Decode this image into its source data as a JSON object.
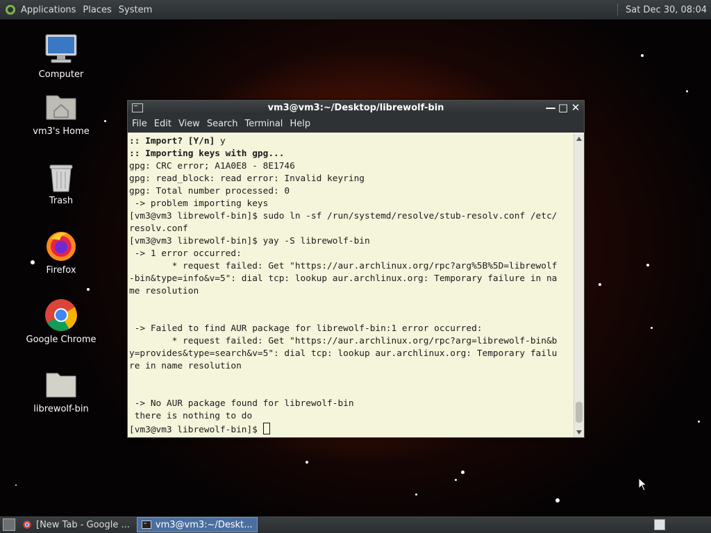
{
  "top_panel": {
    "menus": [
      "Applications",
      "Places",
      "System"
    ],
    "clock": "Sat Dec 30, 08:04"
  },
  "desktop_icons": [
    {
      "label": "Computer",
      "icon": "computer-icon"
    },
    {
      "label": "vm3's Home",
      "icon": "home-folder-icon"
    },
    {
      "label": "Trash",
      "icon": "trash-icon"
    },
    {
      "label": "Firefox",
      "icon": "firefox-icon"
    },
    {
      "label": "Google Chrome",
      "icon": "chrome-icon"
    },
    {
      "label": "librewolf-bin",
      "icon": "folder-icon"
    }
  ],
  "terminal": {
    "title": "vm3@vm3:~/Desktop/librewolf-bin",
    "menu": [
      "File",
      "Edit",
      "View",
      "Search",
      "Terminal",
      "Help"
    ],
    "lines": [
      {
        "text": ":: Import? [Y/n] y",
        "bold_prefix": ":: Import? [Y/n]"
      },
      {
        "text": ":: Importing keys with gpg...",
        "bold_prefix": ":: Importing keys with gpg..."
      },
      {
        "text": "gpg: CRC error; A1A0E8 - 8E1746"
      },
      {
        "text": "gpg: read_block: read error: Invalid keyring"
      },
      {
        "text": "gpg: Total number processed: 0"
      },
      {
        "text": " -> problem importing keys"
      },
      {
        "text": "[vm3@vm3 librewolf-bin]$ sudo ln -sf /run/systemd/resolve/stub-resolv.conf /etc/"
      },
      {
        "text": "resolv.conf"
      },
      {
        "text": "[vm3@vm3 librewolf-bin]$ yay -S librewolf-bin"
      },
      {
        "text": " -> 1 error occurred:"
      },
      {
        "text": "        * request failed: Get \"https://aur.archlinux.org/rpc?arg%5B%5D=librewolf"
      },
      {
        "text": "-bin&type=info&v=5\": dial tcp: lookup aur.archlinux.org: Temporary failure in na"
      },
      {
        "text": "me resolution"
      },
      {
        "text": ""
      },
      {
        "text": ""
      },
      {
        "text": " -> Failed to find AUR package for librewolf-bin:1 error occurred:"
      },
      {
        "text": "        * request failed: Get \"https://aur.archlinux.org/rpc?arg=librewolf-bin&b"
      },
      {
        "text": "y=provides&type=search&v=5\": dial tcp: lookup aur.archlinux.org: Temporary failu"
      },
      {
        "text": "re in name resolution"
      },
      {
        "text": ""
      },
      {
        "text": ""
      },
      {
        "text": " -> No AUR package found for librewolf-bin"
      },
      {
        "text": " there is nothing to do"
      },
      {
        "text": "[vm3@vm3 librewolf-bin]$ "
      }
    ]
  },
  "taskbar": {
    "tasks": [
      {
        "label": "[New Tab - Google ...",
        "icon": "chrome-icon",
        "active": false
      },
      {
        "label": "vm3@vm3:~/Deskt...",
        "icon": "terminal-icon",
        "active": true
      }
    ]
  }
}
